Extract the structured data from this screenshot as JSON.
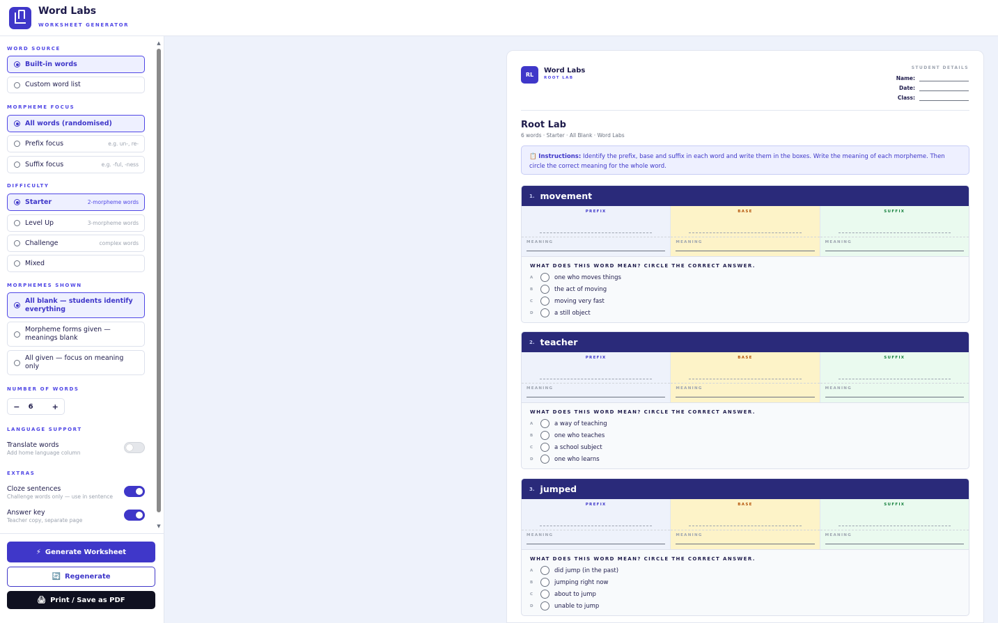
{
  "app": {
    "title": "Word Labs",
    "subtitle": "WORKSHEET GENERATOR"
  },
  "sidebar": {
    "word_source": {
      "label": "WORD SOURCE",
      "options": [
        {
          "label": "Built-in words",
          "selected": true
        },
        {
          "label": "Custom word list",
          "selected": false
        }
      ]
    },
    "morpheme_focus": {
      "label": "MORPHEME FOCUS",
      "options": [
        {
          "label": "All words (randomised)",
          "hint": "",
          "selected": true
        },
        {
          "label": "Prefix focus",
          "hint": "e.g. un-, re-",
          "selected": false
        },
        {
          "label": "Suffix focus",
          "hint": "e.g. -ful, -ness",
          "selected": false
        }
      ]
    },
    "difficulty": {
      "label": "DIFFICULTY",
      "options": [
        {
          "label": "Starter",
          "hint": "2-morpheme words",
          "selected": true
        },
        {
          "label": "Level Up",
          "hint": "3-morpheme words",
          "selected": false
        },
        {
          "label": "Challenge",
          "hint": "complex words",
          "selected": false
        },
        {
          "label": "Mixed",
          "hint": "",
          "selected": false
        }
      ]
    },
    "morphemes_shown": {
      "label": "MORPHEMES SHOWN",
      "options": [
        {
          "label": "All blank — students identify everything",
          "selected": true
        },
        {
          "label": "Morpheme forms given — meanings blank",
          "selected": false
        },
        {
          "label": "All given — focus on meaning only",
          "selected": false
        }
      ]
    },
    "number_of_words": {
      "label": "NUMBER OF WORDS",
      "minus": "−",
      "value": "6",
      "plus": "+"
    },
    "language_support": {
      "label": "LANGUAGE SUPPORT",
      "translate": {
        "title": "Translate words",
        "sub": "Add home language column",
        "on": false
      }
    },
    "extras": {
      "label": "EXTRAS",
      "cloze": {
        "title": "Cloze sentences",
        "sub": "Challenge words only — use in sentence",
        "on": true
      },
      "answer_key": {
        "title": "Answer key",
        "sub": "Teacher copy, separate page",
        "on": true
      }
    },
    "actions": {
      "generate": {
        "icon": "⚡",
        "label": "Generate Worksheet"
      },
      "regenerate": {
        "icon": "🔄",
        "label": "Regenerate"
      },
      "print": {
        "icon": "🖨",
        "label": "Print / Save as PDF"
      }
    }
  },
  "worksheet": {
    "badge": "RL",
    "brand": "Word Labs",
    "brand_sub": "ROOT LAB",
    "student_details": {
      "title": "STUDENT DETAILS",
      "fields": [
        "Name:",
        "Date:",
        "Class:"
      ]
    },
    "title": "Root Lab",
    "meta": "6 words · Starter · All Blank · Word Labs",
    "instructions": {
      "icon": "📋",
      "label": "Instructions:",
      "text": " Identify the prefix, base and suffix in each word and write them in the boxes. Write the meaning of each morpheme. Then circle the correct meaning for the whole word."
    },
    "columns": {
      "prefix": "PREFIX",
      "base": "BASE",
      "suffix": "SUFFIX",
      "meaning": "MEANING"
    },
    "question": "WHAT DOES THIS WORD MEAN? CIRCLE THE CORRECT ANSWER.",
    "words": [
      {
        "num": "1.",
        "word": "movement",
        "choices": [
          {
            "letter": "A",
            "text": "one who moves things"
          },
          {
            "letter": "B",
            "text": "the act of moving"
          },
          {
            "letter": "C",
            "text": "moving very fast"
          },
          {
            "letter": "D",
            "text": "a still object"
          }
        ]
      },
      {
        "num": "2.",
        "word": "teacher",
        "choices": [
          {
            "letter": "A",
            "text": "a way of teaching"
          },
          {
            "letter": "B",
            "text": "one who teaches"
          },
          {
            "letter": "C",
            "text": "a school subject"
          },
          {
            "letter": "D",
            "text": "one who learns"
          }
        ]
      },
      {
        "num": "3.",
        "word": "jumped",
        "choices": [
          {
            "letter": "A",
            "text": "did jump (in the past)"
          },
          {
            "letter": "B",
            "text": "jumping right now"
          },
          {
            "letter": "C",
            "text": "about to jump"
          },
          {
            "letter": "D",
            "text": "unable to jump"
          }
        ]
      }
    ]
  },
  "colors": {
    "accent": "#3f37c9",
    "header_band": "#2a2a7a",
    "base_fill": "#fdf3c8",
    "suffix_fill": "#eafaef"
  }
}
